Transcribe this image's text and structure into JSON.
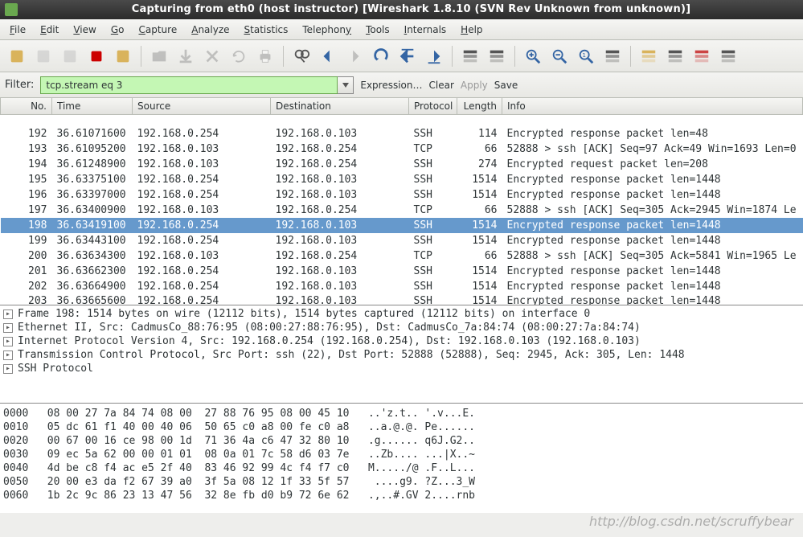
{
  "titlebar": {
    "text": "Capturing from eth0 (host instructor)    [Wireshark 1.8.10  (SVN Rev Unknown from unknown)]"
  },
  "menu": [
    {
      "label": "File",
      "u": "F"
    },
    {
      "label": "Edit",
      "u": "E"
    },
    {
      "label": "View",
      "u": "V"
    },
    {
      "label": "Go",
      "u": "G"
    },
    {
      "label": "Capture",
      "u": "C"
    },
    {
      "label": "Analyze",
      "u": "A"
    },
    {
      "label": "Statistics",
      "u": "S"
    },
    {
      "label": "Telephony",
      "u": "y"
    },
    {
      "label": "Tools",
      "u": "T"
    },
    {
      "label": "Internals",
      "u": "I"
    },
    {
      "label": "Help",
      "u": "H"
    }
  ],
  "toolbar": {
    "icons": [
      {
        "name": "interfaces-icon",
        "color": "#d9b35c"
      },
      {
        "name": "options-icon",
        "color": "#bbb",
        "disabled": true
      },
      {
        "name": "start-icon",
        "color": "#bbb",
        "disabled": true
      },
      {
        "name": "stop-icon",
        "color": "#cc0000"
      },
      {
        "name": "restart-icon",
        "color": "#d9b35c"
      },
      {
        "name": "sep"
      },
      {
        "name": "open-icon",
        "color": "#888",
        "disabled": true
      },
      {
        "name": "save-icon",
        "color": "#888",
        "disabled": true
      },
      {
        "name": "close-icon",
        "color": "#888",
        "disabled": true
      },
      {
        "name": "reload-icon",
        "color": "#888",
        "disabled": true
      },
      {
        "name": "print-icon",
        "color": "#888",
        "disabled": true
      },
      {
        "name": "sep"
      },
      {
        "name": "find-icon",
        "color": "#555"
      },
      {
        "name": "back-icon",
        "color": "#3465a4"
      },
      {
        "name": "forward-icon",
        "color": "#888",
        "disabled": true
      },
      {
        "name": "jump-icon",
        "color": "#3465a4"
      },
      {
        "name": "go-first-icon",
        "color": "#3465a4"
      },
      {
        "name": "go-last-icon",
        "color": "#3465a4"
      },
      {
        "name": "sep"
      },
      {
        "name": "colorize-icon",
        "color": "#555"
      },
      {
        "name": "autoscroll-icon",
        "color": "#555"
      },
      {
        "name": "sep"
      },
      {
        "name": "zoom-in-icon",
        "color": "#3465a4"
      },
      {
        "name": "zoom-out-icon",
        "color": "#3465a4"
      },
      {
        "name": "zoom-reset-icon",
        "color": "#3465a4"
      },
      {
        "name": "resize-cols-icon",
        "color": "#555"
      },
      {
        "name": "sep"
      },
      {
        "name": "capture-filter-icon",
        "color": "#d9b35c"
      },
      {
        "name": "display-filter-icon",
        "color": "#555"
      },
      {
        "name": "coloring-rules-icon",
        "color": "#c44"
      },
      {
        "name": "preferences-icon",
        "color": "#555"
      }
    ]
  },
  "filter": {
    "label": "Filter:",
    "value": "tcp.stream eq 3",
    "links": {
      "expression": "Expression…",
      "clear": "Clear",
      "apply": "Apply",
      "save": "Save"
    }
  },
  "columns": [
    "No.",
    "Time",
    "Source",
    "Destination",
    "Protocol",
    "Length",
    "Info"
  ],
  "rows": [
    {
      "n": "192",
      "t": "36.61071600",
      "s": "192.168.0.254",
      "d": "192.168.0.103",
      "p": "SSH",
      "l": "114",
      "i": "Encrypted response packet len=48"
    },
    {
      "n": "193",
      "t": "36.61095200",
      "s": "192.168.0.103",
      "d": "192.168.0.254",
      "p": "TCP",
      "l": "66",
      "i": "52888 > ssh [ACK] Seq=97 Ack=49 Win=1693 Len=0"
    },
    {
      "n": "194",
      "t": "36.61248900",
      "s": "192.168.0.103",
      "d": "192.168.0.254",
      "p": "SSH",
      "l": "274",
      "i": "Encrypted request packet len=208"
    },
    {
      "n": "195",
      "t": "36.63375100",
      "s": "192.168.0.254",
      "d": "192.168.0.103",
      "p": "SSH",
      "l": "1514",
      "i": "Encrypted response packet len=1448"
    },
    {
      "n": "196",
      "t": "36.63397000",
      "s": "192.168.0.254",
      "d": "192.168.0.103",
      "p": "SSH",
      "l": "1514",
      "i": "Encrypted response packet len=1448"
    },
    {
      "n": "197",
      "t": "36.63400900",
      "s": "192.168.0.103",
      "d": "192.168.0.254",
      "p": "TCP",
      "l": "66",
      "i": "52888 > ssh [ACK] Seq=305 Ack=2945 Win=1874 Le"
    },
    {
      "n": "198",
      "t": "36.63419100",
      "s": "192.168.0.254",
      "d": "192.168.0.103",
      "p": "SSH",
      "l": "1514",
      "i": "Encrypted response packet len=1448"
    },
    {
      "n": "199",
      "t": "36.63443100",
      "s": "192.168.0.254",
      "d": "192.168.0.103",
      "p": "SSH",
      "l": "1514",
      "i": "Encrypted response packet len=1448"
    },
    {
      "n": "200",
      "t": "36.63634300",
      "s": "192.168.0.103",
      "d": "192.168.0.254",
      "p": "TCP",
      "l": "66",
      "i": "52888 > ssh [ACK] Seq=305 Ack=5841 Win=1965 Le"
    },
    {
      "n": "201",
      "t": "36.63662300",
      "s": "192.168.0.254",
      "d": "192.168.0.103",
      "p": "SSH",
      "l": "1514",
      "i": "Encrypted response packet len=1448"
    },
    {
      "n": "202",
      "t": "36.63664900",
      "s": "192.168.0.254",
      "d": "192.168.0.103",
      "p": "SSH",
      "l": "1514",
      "i": "Encrypted response packet len=1448"
    },
    {
      "n": "203",
      "t": "36.63665600",
      "s": "192.168.0.254",
      "d": "192.168.0.103",
      "p": "SSH",
      "l": "1514",
      "i": "Encrypted response packet len=1448"
    }
  ],
  "selected_row_index": 6,
  "partial_top": {
    "n": "",
    "t": "",
    "s": "",
    "d": "",
    "p": "",
    "l": "",
    "i": ""
  },
  "details": [
    {
      "label": "Frame 198: 1514 bytes on wire (12112 bits), 1514 bytes captured (12112 bits) on interface 0"
    },
    {
      "label": "Ethernet II, Src: CadmusCo_88:76:95 (08:00:27:88:76:95), Dst: CadmusCo_7a:84:74 (08:00:27:7a:84:74)"
    },
    {
      "label": "Internet Protocol Version 4, Src: 192.168.0.254 (192.168.0.254), Dst: 192.168.0.103 (192.168.0.103)"
    },
    {
      "label": "Transmission Control Protocol, Src Port: ssh (22), Dst Port: 52888 (52888), Seq: 2945, Ack: 305, Len: 1448"
    },
    {
      "label": "SSH Protocol"
    }
  ],
  "hex": [
    "0000   08 00 27 7a 84 74 08 00  27 88 76 95 08 00 45 10   ..'z.t.. '.v...E.",
    "0010   05 dc 61 f1 40 00 40 06  50 65 c0 a8 00 fe c0 a8   ..a.@.@. Pe......",
    "0020   00 67 00 16 ce 98 00 1d  71 36 4a c6 47 32 80 10   .g...... q6J.G2..",
    "0030   09 ec 5a 62 00 00 01 01  08 0a 01 7c 58 d6 03 7e   ..Zb.... ...|X..~",
    "0040   4d be c8 f4 ac e5 2f 40  83 46 92 99 4c f4 f7 c0   M...../@ .F..L...",
    "0050   20 00 e3 da f2 67 39 a0  3f 5a 08 12 1f 33 5f 57    ....g9. ?Z...3_W",
    "0060   1b 2c 9c 86 23 13 47 56  32 8e fb d0 b9 72 6e 62   .,..#.GV 2....rnb"
  ],
  "watermark": "http://blog.csdn.net/scruffybear"
}
